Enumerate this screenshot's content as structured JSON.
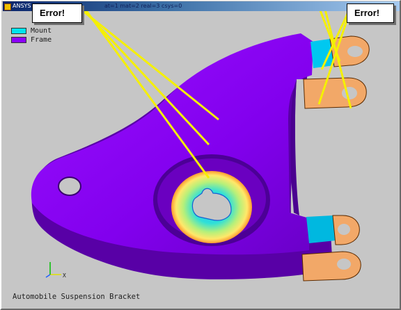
{
  "window": {
    "title": "ANSYS 6",
    "status_line": "at=1 mat=2 real=3 csys=0"
  },
  "legend": [
    {
      "label": "Mount",
      "color": "#00e5ee"
    },
    {
      "label": "Frame",
      "color": "#8b00ff"
    }
  ],
  "caption": "Automobile Suspension Bracket",
  "triad": {
    "axis_label": "X"
  },
  "callouts": {
    "left": "Error!",
    "right": "Error!"
  },
  "colors": {
    "frame": "#8a00f0",
    "frame_shadow": "#5a00a8",
    "mount": "#00c8f0",
    "lug": "#f2a868",
    "error_line": "#f5f000"
  }
}
